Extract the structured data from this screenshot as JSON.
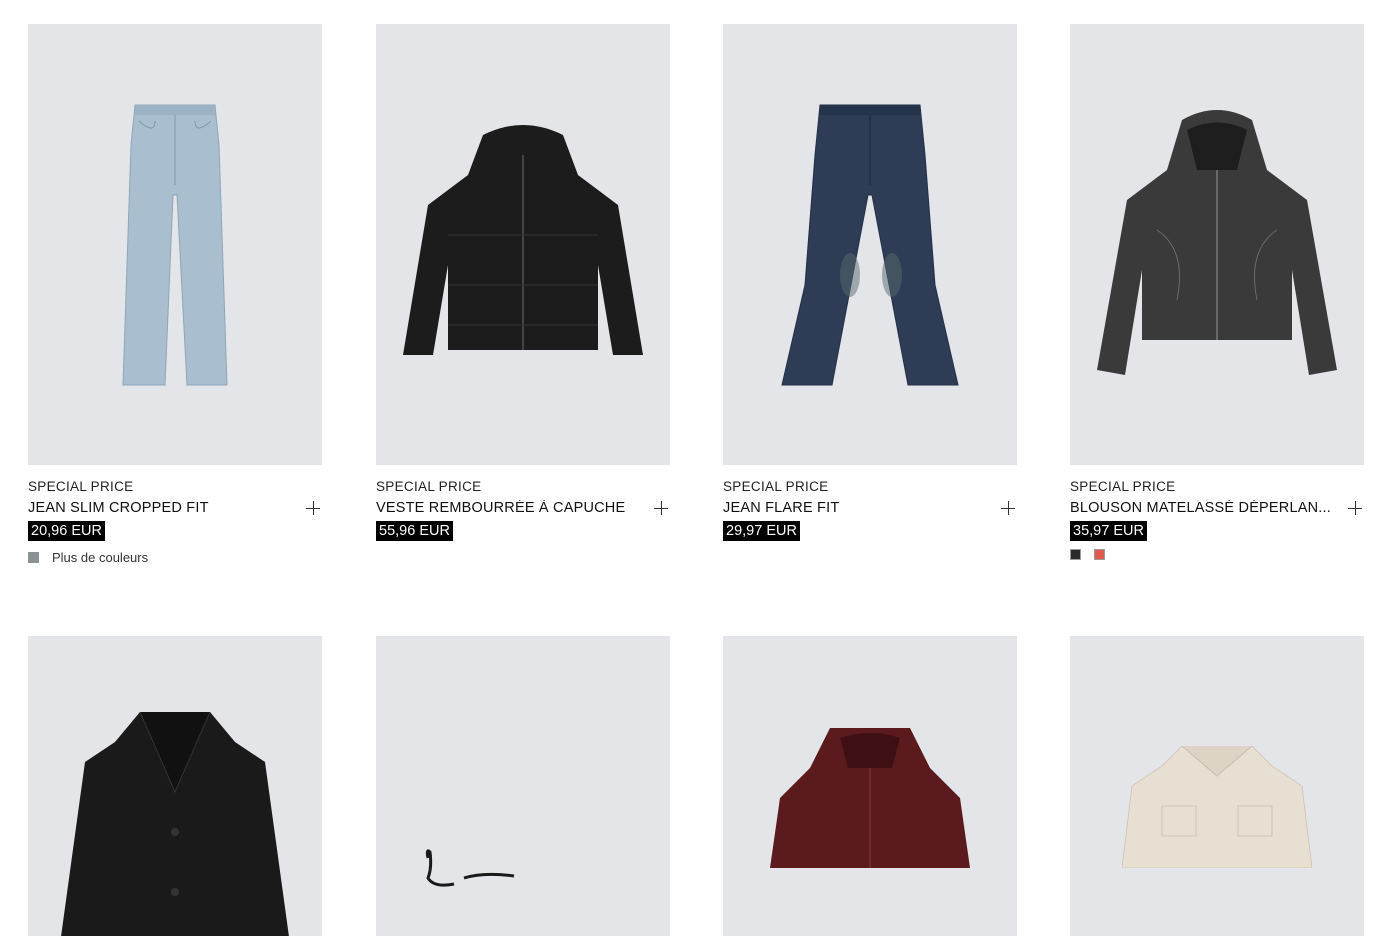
{
  "products_row1": [
    {
      "label": "SPECIAL PRICE",
      "name": "JEAN SLIM CROPPED FIT",
      "price": "20,96 EUR",
      "more_colors": "Plus de couleurs",
      "swatch_color": "#8a9296"
    },
    {
      "label": "SPECIAL PRICE",
      "name": "VESTE REMBOURRÉE À CAPUCHE",
      "price": "55,96 EUR"
    },
    {
      "label": "SPECIAL PRICE",
      "name": "JEAN FLARE FIT",
      "price": "29,97 EUR"
    },
    {
      "label": "SPECIAL PRICE",
      "name": "BLOUSON MATELASSÉ DÉPERLAN...",
      "price": "35,97 EUR",
      "swatches": [
        "#2a2a2a",
        "#e05a4e"
      ]
    }
  ],
  "products_row2": [
    {
      "image": "black-coat"
    },
    {
      "image": "shoe"
    },
    {
      "image": "burgundy-hooded-jacket"
    },
    {
      "image": "cream-fleece-overshirt"
    }
  ],
  "colors": {
    "image_bg": "#e3e5e8",
    "price_bg": "#000000",
    "price_text": "#ffffff"
  }
}
